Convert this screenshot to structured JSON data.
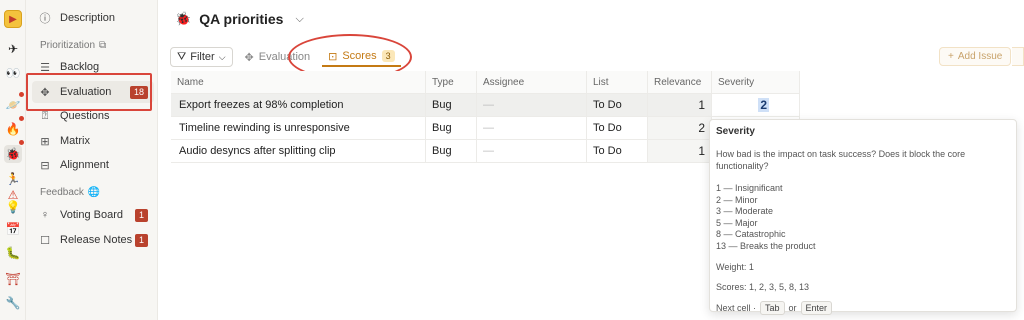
{
  "rail": {
    "icons": [
      "app-logo-icon",
      "gear-icon",
      "eye-icon",
      "planet-icon",
      "fire-icon",
      "bug-icon",
      "running-icon",
      "warning-icon",
      "lightbulb-icon",
      "calendar-icon",
      "bug-purple-icon",
      "gate-icon",
      "wrench-icon"
    ]
  },
  "sidebar": {
    "description": "Description",
    "prioritization_header": "Prioritization",
    "backlog": "Backlog",
    "evaluation": "Evaluation",
    "evaluation_badge": "18",
    "questions": "Questions",
    "matrix": "Matrix",
    "alignment": "Alignment",
    "feedback_header": "Feedback",
    "voting_board": "Voting Board",
    "voting_badge": "1",
    "release_notes": "Release Notes",
    "release_badge": "1"
  },
  "header": {
    "title": "QA priorities"
  },
  "toolbar": {
    "filter": "Filter",
    "tab_evaluation": "Evaluation",
    "tab_scores": "Scores",
    "scores_count": "3",
    "add_issue": "Add Issue"
  },
  "table": {
    "columns": [
      "Name",
      "Type",
      "Assignee",
      "List",
      "Relevance",
      "Severity"
    ],
    "rows": [
      {
        "name": "Export freezes at 98% completion",
        "type": "Bug",
        "assignee": "—",
        "list": "To Do",
        "relevance": "1",
        "severity": "2"
      },
      {
        "name": "Timeline rewinding is unresponsive",
        "type": "Bug",
        "assignee": "—",
        "list": "To Do",
        "relevance": "2",
        "severity": ""
      },
      {
        "name": "Audio desyncs after splitting clip",
        "type": "Bug",
        "assignee": "—",
        "list": "To Do",
        "relevance": "1",
        "severity": ""
      }
    ]
  },
  "tooltip": {
    "title": "Severity",
    "description": "How bad is the impact on task success? Does it block the core functionality?",
    "scale": [
      "1 — Insignificant",
      "2 — Minor",
      "3 — Moderate",
      "5 — Major",
      "8 — Catastrophic",
      "13 — Breaks the product"
    ],
    "weight": "Weight: 1",
    "scores": "Scores: 1, 2, 3, 5, 8, 13",
    "next_cell": "Next cell ·",
    "key_tab": "Tab",
    "or": "or",
    "key_enter": "Enter"
  },
  "colors": {
    "accent": "#c47a14",
    "badge": "#b9422d",
    "highlight": "#d9453a"
  }
}
